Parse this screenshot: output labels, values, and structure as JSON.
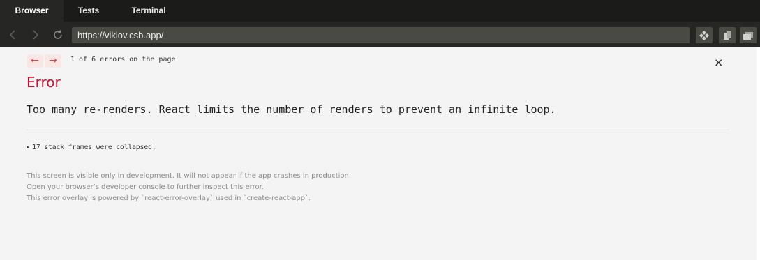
{
  "tabs": [
    {
      "label": "Browser",
      "active": true
    },
    {
      "label": "Tests",
      "active": false
    },
    {
      "label": "Terminal",
      "active": false
    }
  ],
  "navigation": {
    "back_icon": "chevron-left-icon",
    "forward_icon": "chevron-right-icon",
    "refresh_icon": "refresh-icon",
    "url": "https://viklov.csb.app/"
  },
  "toolbar": {
    "icons": [
      "drag-move-icon",
      "copy-icon",
      "windows-icon"
    ]
  },
  "error_overlay": {
    "prev_arrow": "←",
    "next_arrow": "→",
    "count_text": "1 of 6 errors on the page",
    "close_symbol": "×",
    "title": "Error",
    "message": "Too many re-renders. React limits the number of renders to prevent an infinite loop.",
    "stack_frames_text": "17 stack frames were collapsed.",
    "footer_lines": [
      "This screen is visible only in development. It will not appear if the app crashes in production.",
      "Open your browser’s developer console to further inspect this error.",
      "This error overlay is powered by `react-error-overlay` used in `create-react-app`."
    ],
    "colors": {
      "title": "#c8102e",
      "arrows": "#d34747",
      "arrow_bg": "#fbe6e6"
    }
  }
}
